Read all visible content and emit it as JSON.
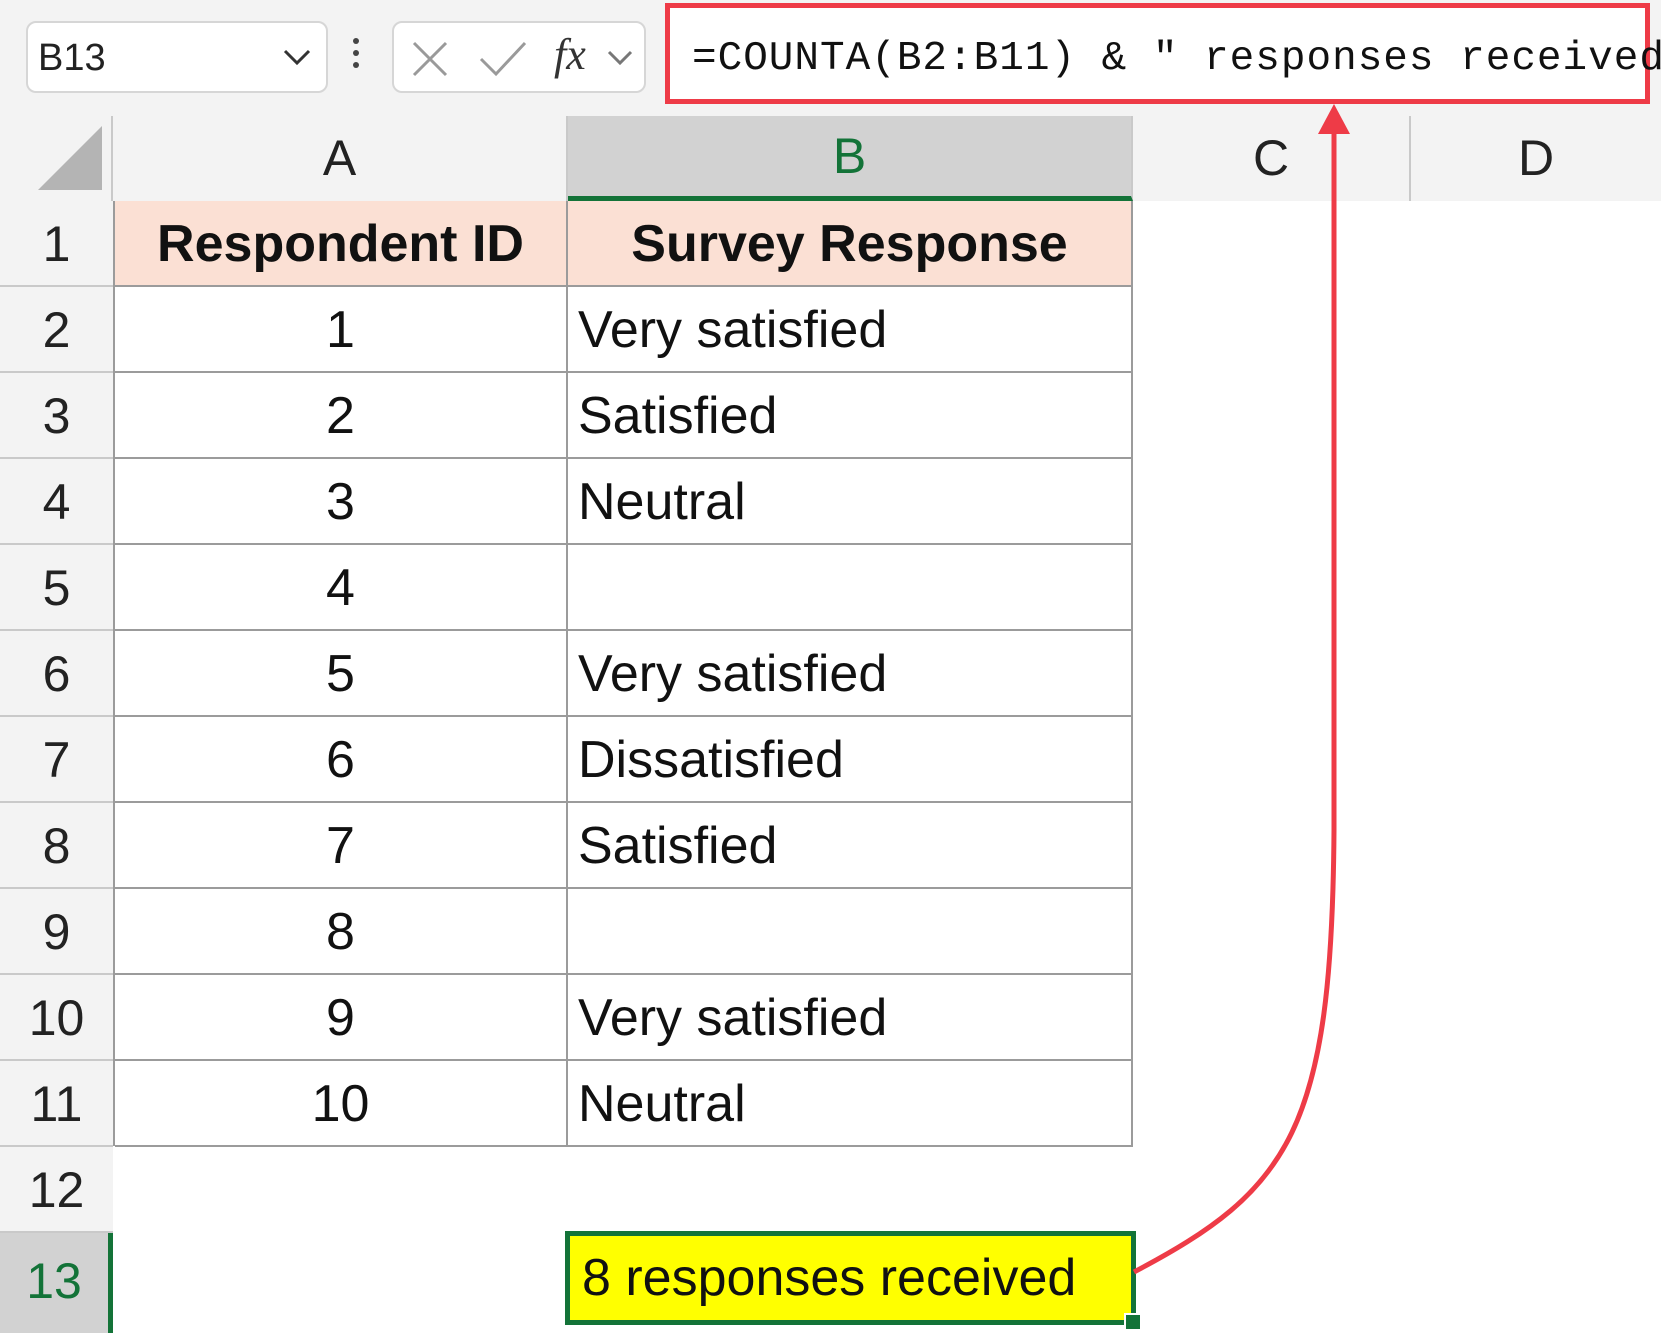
{
  "formula_bar": {
    "name_box": "B13",
    "fx_label": "fx",
    "formula": "=COUNTA(B2:B11) & \" responses received\""
  },
  "columns": [
    "A",
    "B",
    "C",
    "D"
  ],
  "rows": [
    "1",
    "2",
    "3",
    "4",
    "5",
    "6",
    "7",
    "8",
    "9",
    "10",
    "11",
    "12",
    "13"
  ],
  "table": {
    "headers": [
      "Respondent ID",
      "Survey Response"
    ],
    "rows": [
      {
        "id": "1",
        "response": "Very satisfied"
      },
      {
        "id": "2",
        "response": "Satisfied"
      },
      {
        "id": "3",
        "response": "Neutral"
      },
      {
        "id": "4",
        "response": ""
      },
      {
        "id": "5",
        "response": "Very satisfied"
      },
      {
        "id": "6",
        "response": "Dissatisfied"
      },
      {
        "id": "7",
        "response": "Satisfied"
      },
      {
        "id": "8",
        "response": ""
      },
      {
        "id": "9",
        "response": "Very satisfied"
      },
      {
        "id": "10",
        "response": "Neutral"
      }
    ]
  },
  "result": {
    "cell": "B13",
    "value": "8 responses received"
  },
  "colors": {
    "selection_green": "#137338",
    "highlight_red": "#ee3b47",
    "header_fill": "#fbe0d4",
    "result_fill": "#ffff00"
  }
}
